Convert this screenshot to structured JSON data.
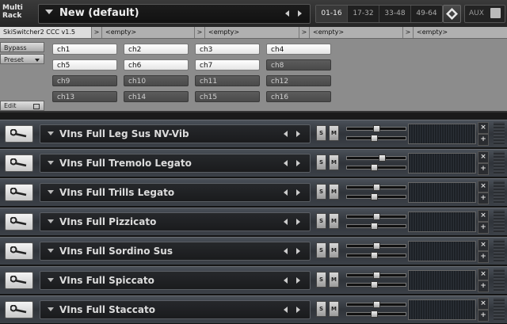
{
  "rack": {
    "label_line1": "Multi",
    "label_line2": "Rack",
    "preset_name": "New (default)",
    "pages": [
      "01-16",
      "17-32",
      "33-48",
      "49-64"
    ],
    "active_page": "01-16",
    "aux_label": "AUX"
  },
  "script_tabs": {
    "active": "SkiSwitcher2 CCC v1.5",
    "others": [
      "<empty>",
      "<empty>",
      "<empty>",
      "<empty>"
    ],
    "arrow_glyph": ">"
  },
  "script_panel": {
    "bypass_label": "Bypass",
    "preset_label": "Preset",
    "edit_label": "Edit",
    "channels": [
      {
        "label": "ch1",
        "state": "on"
      },
      {
        "label": "ch2",
        "state": "on"
      },
      {
        "label": "ch3",
        "state": "on"
      },
      {
        "label": "ch4",
        "state": "on"
      },
      {
        "label": "ch5",
        "state": "on"
      },
      {
        "label": "ch6",
        "state": "on"
      },
      {
        "label": "ch7",
        "state": "on"
      },
      {
        "label": "ch8",
        "state": "off"
      },
      {
        "label": "ch9",
        "state": "off"
      },
      {
        "label": "ch10",
        "state": "off"
      },
      {
        "label": "ch11",
        "state": "off"
      },
      {
        "label": "ch12",
        "state": "off"
      },
      {
        "label": "ch13",
        "state": "off"
      },
      {
        "label": "ch14",
        "state": "off"
      },
      {
        "label": "ch15",
        "state": "off"
      },
      {
        "label": "ch16",
        "state": "off"
      }
    ]
  },
  "instruments": [
    {
      "name": "VIns Full Leg Sus NV-Vib",
      "solo": "S",
      "mute": "M"
    },
    {
      "name": "VIns Full Tremolo Legato",
      "solo": "S",
      "mute": "M"
    },
    {
      "name": "VIns Full Trills Legato",
      "solo": "S",
      "mute": "M"
    },
    {
      "name": "VIns Full Pizzicato",
      "solo": "S",
      "mute": "M"
    },
    {
      "name": "VIns Full Sordino Sus",
      "solo": "S",
      "mute": "M"
    },
    {
      "name": "VIns Full Spiccato",
      "solo": "S",
      "mute": "M"
    },
    {
      "name": "VIns Full Staccato",
      "solo": "S",
      "mute": "M"
    }
  ],
  "instrument_controls": {
    "close_glyph": "×",
    "expand_glyph": "+"
  },
  "icons": {
    "wrench": "wrench-icon",
    "prev": "prev-arrow-icon",
    "next": "next-arrow-icon",
    "dropdown": "dropdown-triangle-icon",
    "kontakt_logo": "kontakt-logo-icon"
  },
  "colors": {
    "background": "#1a1a1a",
    "script_panel": "#8c8c8c",
    "channel_on": "#ffffff",
    "channel_off": "#4a4a4a"
  }
}
